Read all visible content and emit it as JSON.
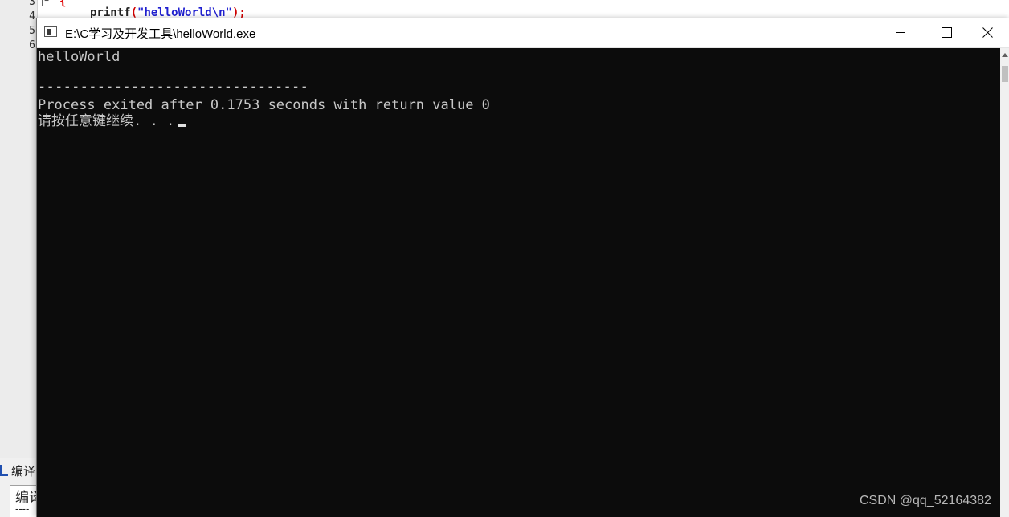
{
  "ide": {
    "line_numbers": [
      "3",
      "4",
      "5",
      "6"
    ],
    "fold_symbol": "−",
    "brace": "{",
    "code": {
      "func": "printf",
      "open": "(",
      "string": "\"helloWorld\\n\"",
      "close": ");"
    },
    "bottom_tab_label": "编译",
    "output_text": "编译",
    "output_dashes": "----"
  },
  "console": {
    "title": "E:\\C学习及开发工具\\helloWorld.exe",
    "lines": {
      "output": "helloWorld",
      "separator": "--------------------------------",
      "process_exit": "Process exited after 0.1753 seconds with return value 0",
      "press_key": "请按任意键继续. . ."
    },
    "background_color": "#0c0c0c",
    "text_color": "#c8c8c8"
  },
  "watermark": "CSDN @qq_52164382"
}
